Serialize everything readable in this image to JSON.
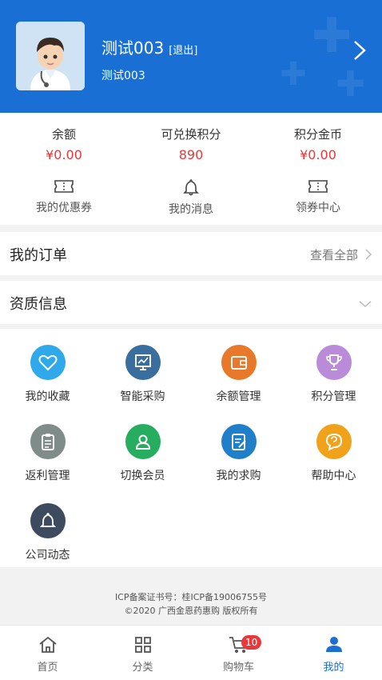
{
  "user": {
    "name": "测试003",
    "logout": "[退出]",
    "sub": "测试003"
  },
  "stats": [
    {
      "label": "余额",
      "value": "¥0.00"
    },
    {
      "label": "可兑换积分",
      "value": "890"
    },
    {
      "label": "积分金币",
      "value": "¥0.00"
    }
  ],
  "quick_links": [
    {
      "label": "我的优惠券",
      "icon": "ticket-icon"
    },
    {
      "label": "我的消息",
      "icon": "bell-icon"
    },
    {
      "label": "领券中心",
      "icon": "ticket-icon"
    }
  ],
  "orders": {
    "title": "我的订单",
    "more": "查看全部"
  },
  "qualification": {
    "title": "资质信息"
  },
  "grid": [
    {
      "label": "我的收藏",
      "icon": "heart-icon",
      "color": "#2fa9ea"
    },
    {
      "label": "智能采购",
      "icon": "monitor-chart-icon",
      "color": "#3a6e9e"
    },
    {
      "label": "余额管理",
      "icon": "wallet-icon",
      "color": "#e9792a"
    },
    {
      "label": "积分管理",
      "icon": "trophy-icon",
      "color": "#b98bd8"
    },
    {
      "label": "返利管理",
      "icon": "clipboard-icon",
      "color": "#7f8c8a"
    },
    {
      "label": "切换会员",
      "icon": "user-switch-icon",
      "color": "#27ad5f"
    },
    {
      "label": "我的求购",
      "icon": "edit-doc-icon",
      "color": "#1f7fc8"
    },
    {
      "label": "帮助中心",
      "icon": "help-chat-icon",
      "color": "#f0a21b"
    },
    {
      "label": "公司动态",
      "icon": "bell-icon",
      "color": "#3e4a5e"
    }
  ],
  "footer": {
    "line1": "ICP备案证书号：桂ICP备19006755号",
    "line2": "©2020 广西金恩药惠购 版权所有"
  },
  "tabs": [
    {
      "label": "首页",
      "icon": "home-icon"
    },
    {
      "label": "分类",
      "icon": "grid-icon"
    },
    {
      "label": "购物车",
      "icon": "cart-icon",
      "badge": "10"
    },
    {
      "label": "我的",
      "icon": "person-icon",
      "active": true
    }
  ],
  "colors": {
    "brand": "#1a6fd4",
    "price": "#e8383a"
  }
}
